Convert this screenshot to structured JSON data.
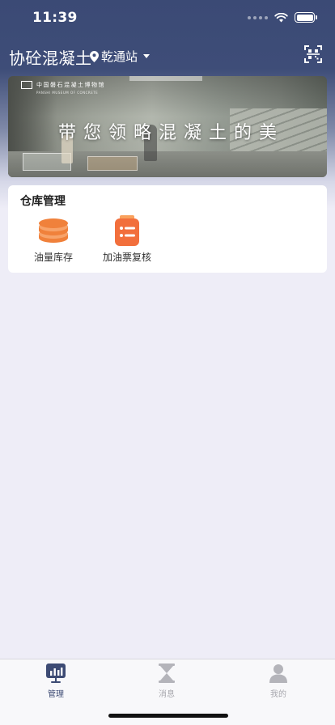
{
  "status_bar": {
    "time": "11:39"
  },
  "nav": {
    "title": "协砼混凝土",
    "location": "乾通站",
    "location_icon": "map-pin-icon",
    "scan_icon": "qr-scan-icon"
  },
  "banner": {
    "logo_cn": "中国磐石混凝土博物馆",
    "logo_en": "PANSHI MUSEUM OF CONCRETE",
    "slogan": "带您领略混凝土的美"
  },
  "warehouse": {
    "title": "仓库管理",
    "items": [
      {
        "label": "油量库存",
        "icon": "oil-stack-icon",
        "color": "#f0813b"
      },
      {
        "label": "加油票复核",
        "icon": "receipt-list-icon",
        "color": "#f26f3c"
      }
    ]
  },
  "tabbar": {
    "items": [
      {
        "label": "管理",
        "icon": "dashboard-icon",
        "active": true,
        "color": "#3d4b74"
      },
      {
        "label": "消息",
        "icon": "hourglass-icon",
        "active": false,
        "color": "#a8a8ae"
      },
      {
        "label": "我的",
        "icon": "user-icon",
        "active": false,
        "color": "#a8a8ae"
      }
    ]
  },
  "colors": {
    "header": "#3b4a75",
    "background": "#eeedf7",
    "accent_orange": "#f0813b"
  }
}
